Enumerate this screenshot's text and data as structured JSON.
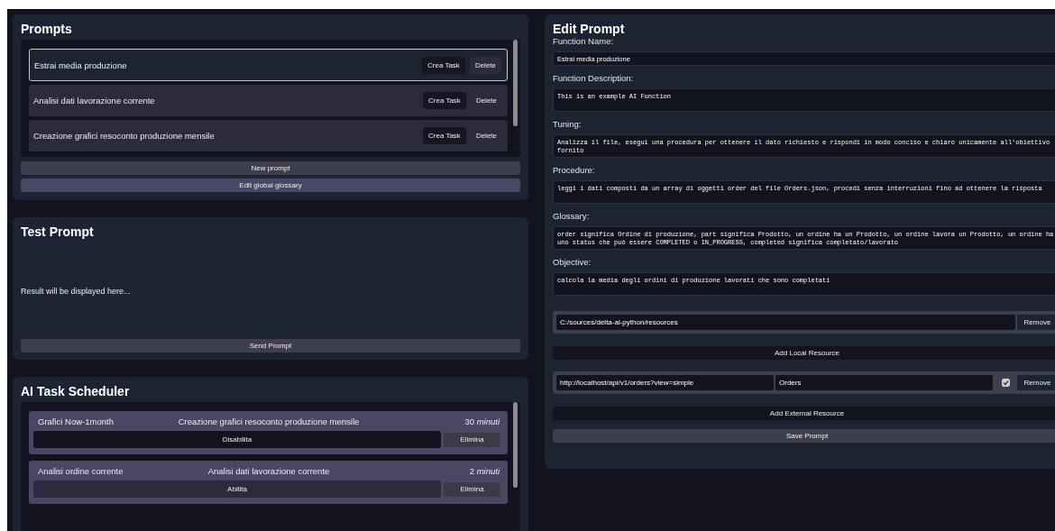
{
  "prompts": {
    "title": "Prompts",
    "items": [
      {
        "name": "Estrai media produzione",
        "selected": true,
        "create_label": "Crea Task",
        "delete_label": "Delete"
      },
      {
        "name": "Analisi dati lavorazione corrente",
        "selected": false,
        "create_label": "Crea Task",
        "delete_label": "Delete"
      },
      {
        "name": "Creazione grafici resoconto produzione mensile",
        "selected": false,
        "create_label": "Crea Task",
        "delete_label": "Delete"
      }
    ],
    "new_button": "New prompt",
    "glossary_button": "Edit global glossary"
  },
  "test": {
    "title": "Test Prompt",
    "result": "Result will be displayed here...",
    "send_button": "Send Prompt"
  },
  "scheduler": {
    "title": "AI Task Scheduler",
    "tasks": [
      {
        "name": "Grafici Now-1month",
        "prompt": "Creazione grafici resoconto produzione mensile",
        "interval": "30 *minuti*",
        "enabled": true,
        "toggle_label": "Disabilita",
        "delete_label": "Elimina"
      },
      {
        "name": "Analisi ordine corrente",
        "prompt": "Analisi dati lavorazione corrente",
        "interval": "2 *minuti*",
        "enabled": false,
        "toggle_label": "Abilita",
        "delete_label": "Elimina"
      }
    ]
  },
  "edit": {
    "title": "Edit Prompt",
    "fields": [
      {
        "label": "Function Name:",
        "value": "Estrai media produzione",
        "kind": "input"
      },
      {
        "label": "Function Description:",
        "value": "This is an example AI Function",
        "kind": "textarea"
      },
      {
        "label": "Tuning:",
        "value": "Analizza il file, esegui una procedura per ottenere il dato richiesto e rispondi in modo conciso e chiaro unicamente all'obiettivo fornito",
        "kind": "textarea"
      },
      {
        "label": "Procedure:",
        "value": "leggi i dati composti da un array di oggetti order del file Orders.json, procedi senza interruzioni fino ad ottenere la risposta",
        "kind": "textarea"
      },
      {
        "label": "Glossary:",
        "value": "order significa Ordine di produzione, part significa Prodotto, un ordine ha un Prodotto, un ordine lavora un Prodotto, un ordine ha uno status che può essere COMPLETED o IN_PROGRESS, completed significa completato/lavorato",
        "kind": "textarea"
      },
      {
        "label": "Objective:",
        "value": "calcola la media degli ordini di produzione lavorati che sono completati",
        "kind": "textarea"
      }
    ],
    "local_resources": [
      {
        "path": "C:/sources/delta-ai-python/resources",
        "remove_label": "Remove"
      }
    ],
    "add_local": "Add Local Resource",
    "external_resources": [
      {
        "url": "http://localhost/api/v1/orders?view=simple",
        "name": "Orders",
        "checked": true,
        "remove_label": "Remove"
      }
    ],
    "add_external": "Add External Resource",
    "save_button": "Save Prompt"
  }
}
